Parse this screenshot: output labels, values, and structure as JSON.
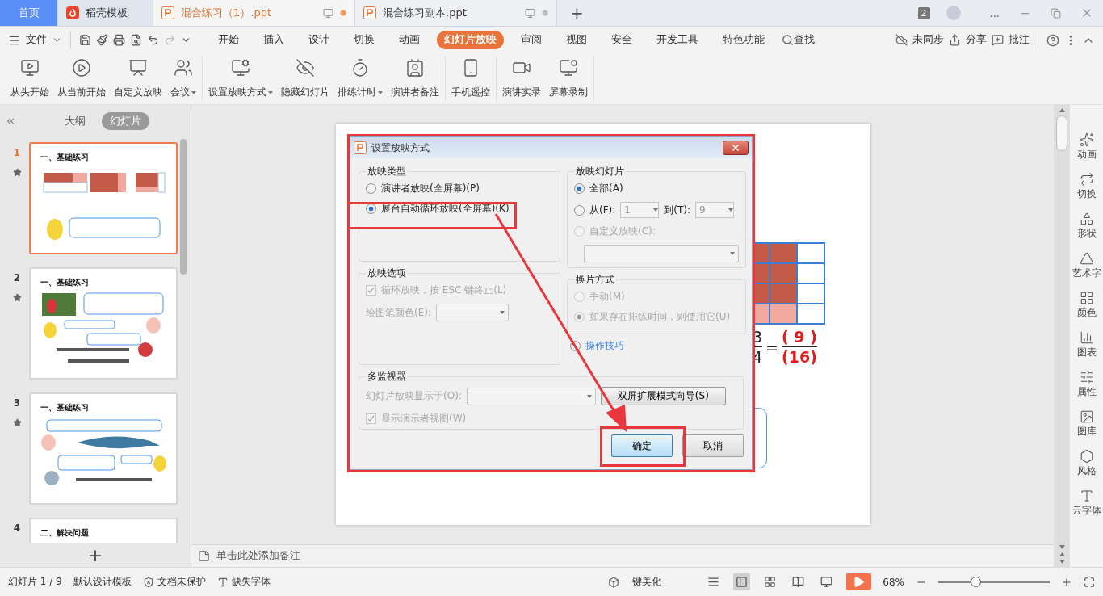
{
  "tabs": [
    {
      "label": "首页",
      "kind": "home",
      "selected": false
    },
    {
      "label": "稻壳模板",
      "kind": "docer",
      "selected": false
    },
    {
      "label": "混合练习（1）.ppt",
      "kind": "doc",
      "selected": true
    },
    {
      "label": "混合练习副本.ppt",
      "kind": "doc",
      "selected": false
    }
  ],
  "new_tab": "+",
  "window_count": "2",
  "more": "...",
  "menu": {
    "file": "文件",
    "tabs": [
      {
        "label": "开始",
        "selected": false
      },
      {
        "label": "插入",
        "selected": false
      },
      {
        "label": "设计",
        "selected": false
      },
      {
        "label": "切换",
        "selected": false
      },
      {
        "label": "动画",
        "selected": false
      },
      {
        "label": "幻灯片放映",
        "selected": true
      },
      {
        "label": "审阅",
        "selected": false
      },
      {
        "label": "视图",
        "selected": false
      },
      {
        "label": "安全",
        "selected": false
      },
      {
        "label": "开发工具",
        "selected": false
      },
      {
        "label": "特色功能",
        "selected": false
      }
    ],
    "search": "查找",
    "sync": "未同步",
    "share": "分享",
    "comment": "批注"
  },
  "ribbon": [
    [
      {
        "label": "从头开始",
        "dropdown": false
      },
      {
        "label": "从当前开始",
        "dropdown": false
      },
      {
        "label": "自定义放映",
        "dropdown": false
      },
      {
        "label": "会议",
        "dropdown": true
      }
    ],
    [
      {
        "label": "设置放映方式",
        "dropdown": true
      },
      {
        "label": "隐藏幻灯片",
        "dropdown": false
      },
      {
        "label": "排练计时",
        "dropdown": true
      },
      {
        "label": "演讲者备注",
        "dropdown": false
      }
    ],
    [
      {
        "label": "手机遥控",
        "dropdown": false
      }
    ],
    [
      {
        "label": "演讲实录",
        "dropdown": false
      },
      {
        "label": "屏幕录制",
        "dropdown": false
      }
    ]
  ],
  "left_panel": {
    "tabs": [
      {
        "label": "大纲",
        "selected": false
      },
      {
        "label": "幻灯片",
        "selected": true
      }
    ],
    "slides": [
      {
        "number": "1",
        "title": "一、基础练习",
        "selected": true,
        "starred": true
      },
      {
        "number": "2",
        "title": "一、基础练习",
        "selected": false,
        "starred": true
      },
      {
        "number": "3",
        "title": "一、基础练习",
        "selected": false,
        "starred": true
      },
      {
        "number": "4",
        "title": "二、解决问题",
        "selected": false
      }
    ],
    "add": "+"
  },
  "slide": {
    "fraction": {
      "left_numerator": "3",
      "left_denominator": "4",
      "equals": "=",
      "numerator": "( 9 )",
      "denominator": "(16)"
    }
  },
  "dialog": {
    "title": "设置放映方式",
    "show_type": {
      "legend": "放映类型",
      "options": [
        {
          "label": "演讲者放映(全屏幕)(P)",
          "selected": false
        },
        {
          "label": "展台自动循环放映(全屏幕)(K)",
          "selected": true
        }
      ]
    },
    "range": {
      "legend": "放映幻灯片",
      "all": {
        "label": "全部(A)",
        "selected": true
      },
      "from": {
        "label": "从(F):",
        "selected": false,
        "value": "1"
      },
      "to": {
        "label": "到(T):",
        "value": "9"
      },
      "custom": {
        "label": "自定义放映(C):",
        "selected": false,
        "disabled": true
      }
    },
    "options": {
      "legend": "放映选项",
      "loop": {
        "label": "循环放映，按 ESC 键终止(L)",
        "checked": true,
        "disabled": true
      },
      "pen": {
        "label": "绘图笔颜色(E):",
        "disabled": true
      }
    },
    "advance": {
      "legend": "换片方式",
      "disabled": true,
      "options": [
        {
          "label": "手动(M)",
          "selected": false
        },
        {
          "label": "如果存在排练时间，则使用它(U)",
          "selected": true
        }
      ]
    },
    "tips": "操作技巧",
    "monitors": {
      "legend": "多监视器",
      "display": {
        "label": "幻灯片放映显示于(O):",
        "disabled": true
      },
      "wizard": "双屏扩展模式向导(S)",
      "presenter": {
        "label": "显示演示者视图(W)",
        "checked": true,
        "disabled": true
      }
    },
    "buttons": [
      {
        "label": "确定",
        "kind": "primary"
      },
      {
        "label": "取消",
        "kind": "secondary"
      }
    ]
  },
  "notes_placeholder": "单击此处添加备注",
  "right_sidebar": [
    "动画",
    "切换",
    "形状",
    "艺术字",
    "颜色",
    "图表",
    "属性",
    "图库",
    "风格",
    "云字体"
  ],
  "status_bar": {
    "slide": "幻灯片 1 / 9",
    "template": "默认设计模板",
    "protection": "文档未保护",
    "fonts": "缺失字体",
    "beautify": "一键美化",
    "zoom": "68%",
    "zoom_slider": {
      "level": 0.33
    }
  }
}
